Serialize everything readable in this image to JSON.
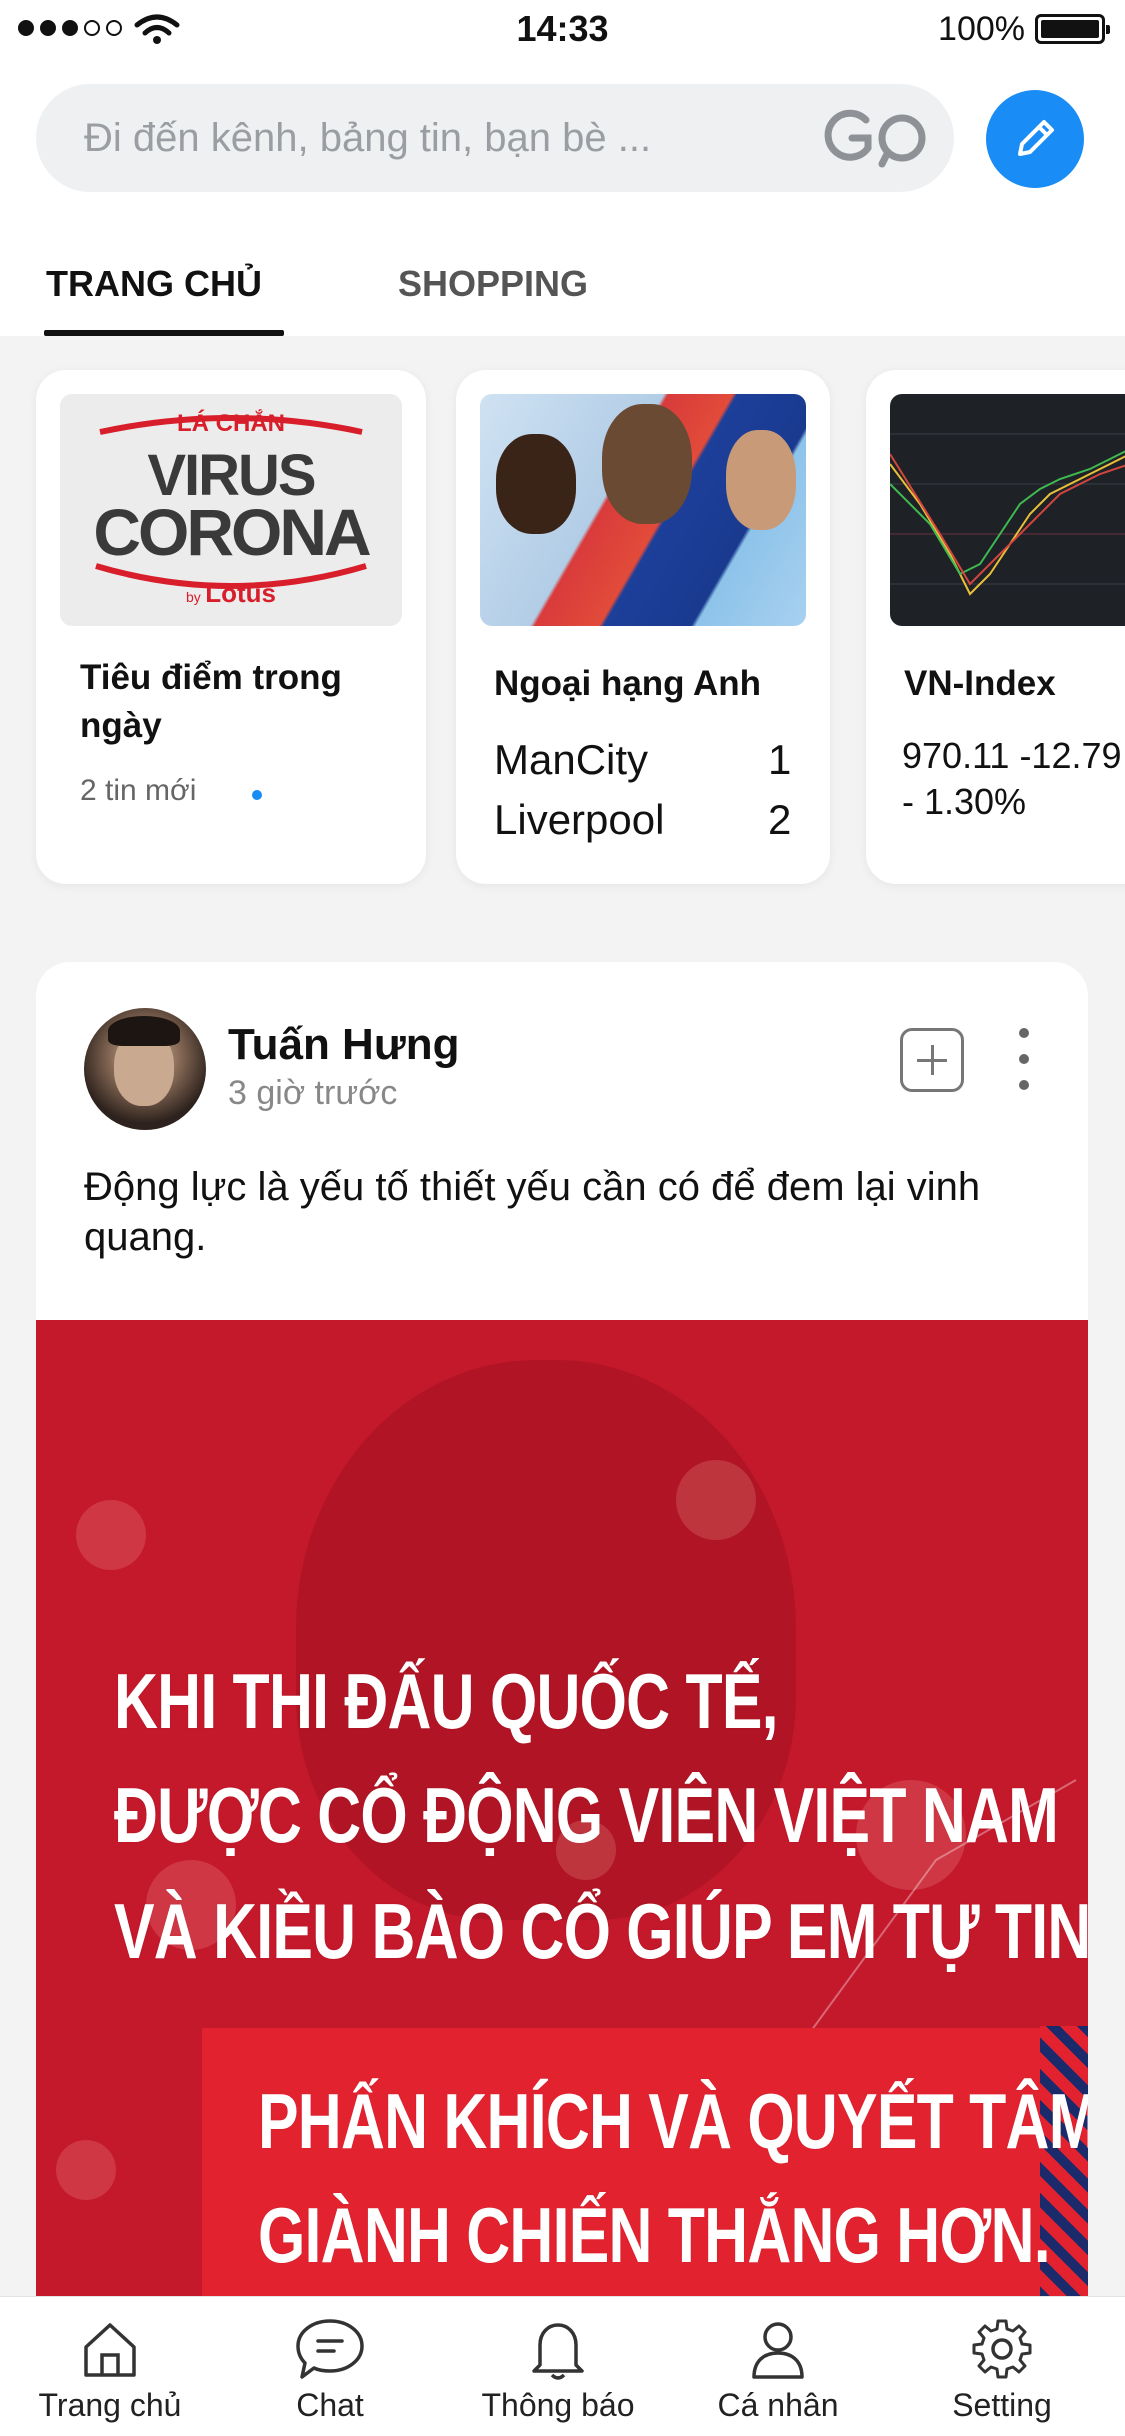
{
  "status_bar": {
    "time": "14:33",
    "battery": "100%"
  },
  "search": {
    "placeholder": "Đi đến kênh, bảng tin, bạn bè ...",
    "logo": "GO"
  },
  "tabs": [
    {
      "label": "TRANG CHỦ",
      "active": true
    },
    {
      "label": "SHOPPING",
      "active": false
    }
  ],
  "highlights": [
    {
      "image_text": {
        "top": "LÁ CHẮN",
        "line1": "VIRUS",
        "line2": "CORONA",
        "by": "by",
        "brand": "Lotus"
      },
      "title": "Tiêu điểm trong ngày",
      "subtitle": "2 tin mới"
    },
    {
      "title": "Ngoại hạng Anh",
      "matches": [
        {
          "team": "ManCity",
          "score": "1"
        },
        {
          "team": "Liverpool",
          "score": "2"
        }
      ]
    },
    {
      "title": "VN-Index",
      "value": "970.11 -12.79",
      "change": "- 1.30%"
    }
  ],
  "post": {
    "author": "Tuấn Hưng",
    "time": "3 giờ trước",
    "text": "Động lực là yếu tố thiết yếu cần có để đem lại vinh quang.",
    "image_quote": [
      "KHI THI ĐẤU QUỐC TẾ,",
      "ĐƯỢC CỔ ĐỘNG VIÊN VIỆT NAM",
      "VÀ KIỀU BÀO CỔ GIÚP EM TỰ TIN,",
      "PHẤN KHÍCH VÀ QUYẾT TÂM",
      "GIÀNH CHIẾN THẮNG HƠN."
    ]
  },
  "bottom_nav": [
    {
      "label": "Trang chủ",
      "icon": "home-icon"
    },
    {
      "label": "Chat",
      "icon": "chat-icon"
    },
    {
      "label": "Thông báo",
      "icon": "bell-icon"
    },
    {
      "label": "Cá nhân",
      "icon": "user-icon"
    },
    {
      "label": "Setting",
      "icon": "gear-icon"
    }
  ],
  "colors": {
    "accent": "#1a8cf5",
    "poster_red": "#c4182b"
  }
}
